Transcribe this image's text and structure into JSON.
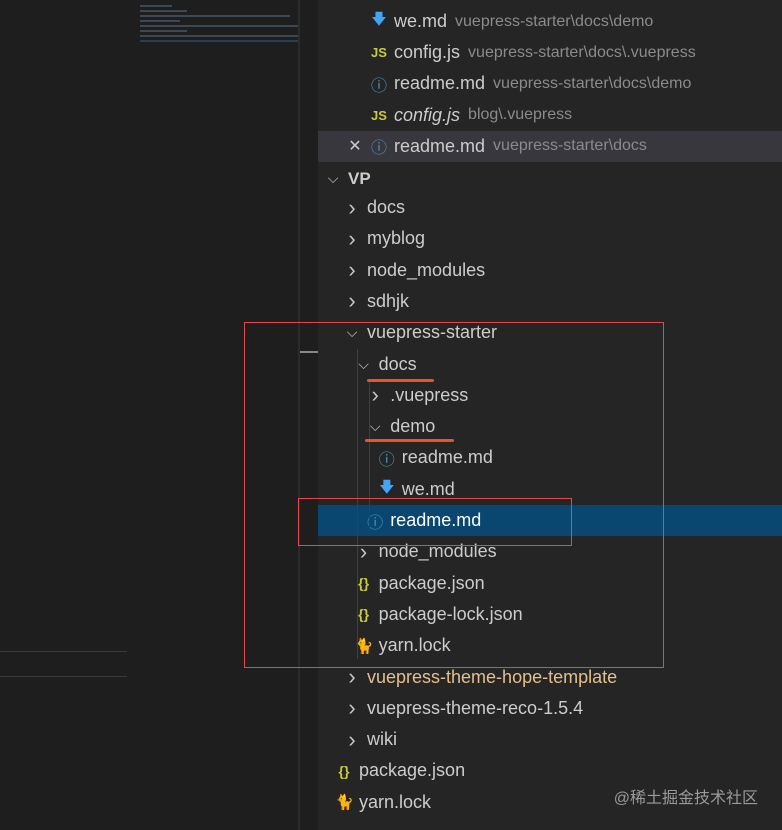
{
  "open_editors": [
    {
      "name": "we.md",
      "path": "vuepress-starter\\docs\\demo",
      "icon": "markdown-icon"
    },
    {
      "name": "config.js",
      "path": "vuepress-starter\\docs\\.vuepress",
      "icon": "js-icon"
    },
    {
      "name": "readme.md",
      "path": "vuepress-starter\\docs\\demo",
      "icon": "info-icon"
    },
    {
      "name": "config.js",
      "path": "blog\\.vuepress",
      "icon": "js-icon",
      "italic": true
    },
    {
      "name": "readme.md",
      "path": "vuepress-starter\\docs",
      "icon": "info-icon",
      "active": true,
      "close": true
    }
  ],
  "explorer": {
    "title": "VP",
    "items": [
      {
        "name": "docs",
        "depth": 0,
        "type": "folder",
        "open": false
      },
      {
        "name": "myblog",
        "depth": 0,
        "type": "folder",
        "open": false
      },
      {
        "name": "node_modules",
        "depth": 0,
        "type": "folder",
        "open": false
      },
      {
        "name": "sdhjk",
        "depth": 0,
        "type": "folder",
        "open": false
      },
      {
        "name": "vuepress-starter",
        "depth": 0,
        "type": "folder",
        "open": true
      },
      {
        "name": "docs",
        "depth": 1,
        "type": "folder",
        "open": true
      },
      {
        "name": ".vuepress",
        "depth": 2,
        "type": "folder",
        "open": false
      },
      {
        "name": "demo",
        "depth": 2,
        "type": "folder",
        "open": true
      },
      {
        "name": "readme.md",
        "depth": 3,
        "type": "info"
      },
      {
        "name": "we.md",
        "depth": 3,
        "type": "markdown"
      },
      {
        "name": "readme.md",
        "depth": 2,
        "type": "info",
        "selected": true
      },
      {
        "name": "node_modules",
        "depth": 1,
        "type": "folder",
        "open": false
      },
      {
        "name": "package.json",
        "depth": 1,
        "type": "json"
      },
      {
        "name": "package-lock.json",
        "depth": 1,
        "type": "json"
      },
      {
        "name": "yarn.lock",
        "depth": 1,
        "type": "yarn"
      },
      {
        "name": "vuepress-theme-hope-template",
        "depth": 0,
        "type": "folder",
        "open": false,
        "modified": true
      },
      {
        "name": "vuepress-theme-reco-1.5.4",
        "depth": 0,
        "type": "folder",
        "open": false
      },
      {
        "name": "wiki",
        "depth": 0,
        "type": "folder",
        "open": false
      },
      {
        "name": "package.json",
        "depth": -1,
        "type": "json"
      },
      {
        "name": "yarn.lock",
        "depth": -1,
        "type": "yarn"
      }
    ]
  },
  "watermark": "@稀土掘金技术社区",
  "colors": {
    "selection": "#094771",
    "annotation": "#e04a4a"
  }
}
